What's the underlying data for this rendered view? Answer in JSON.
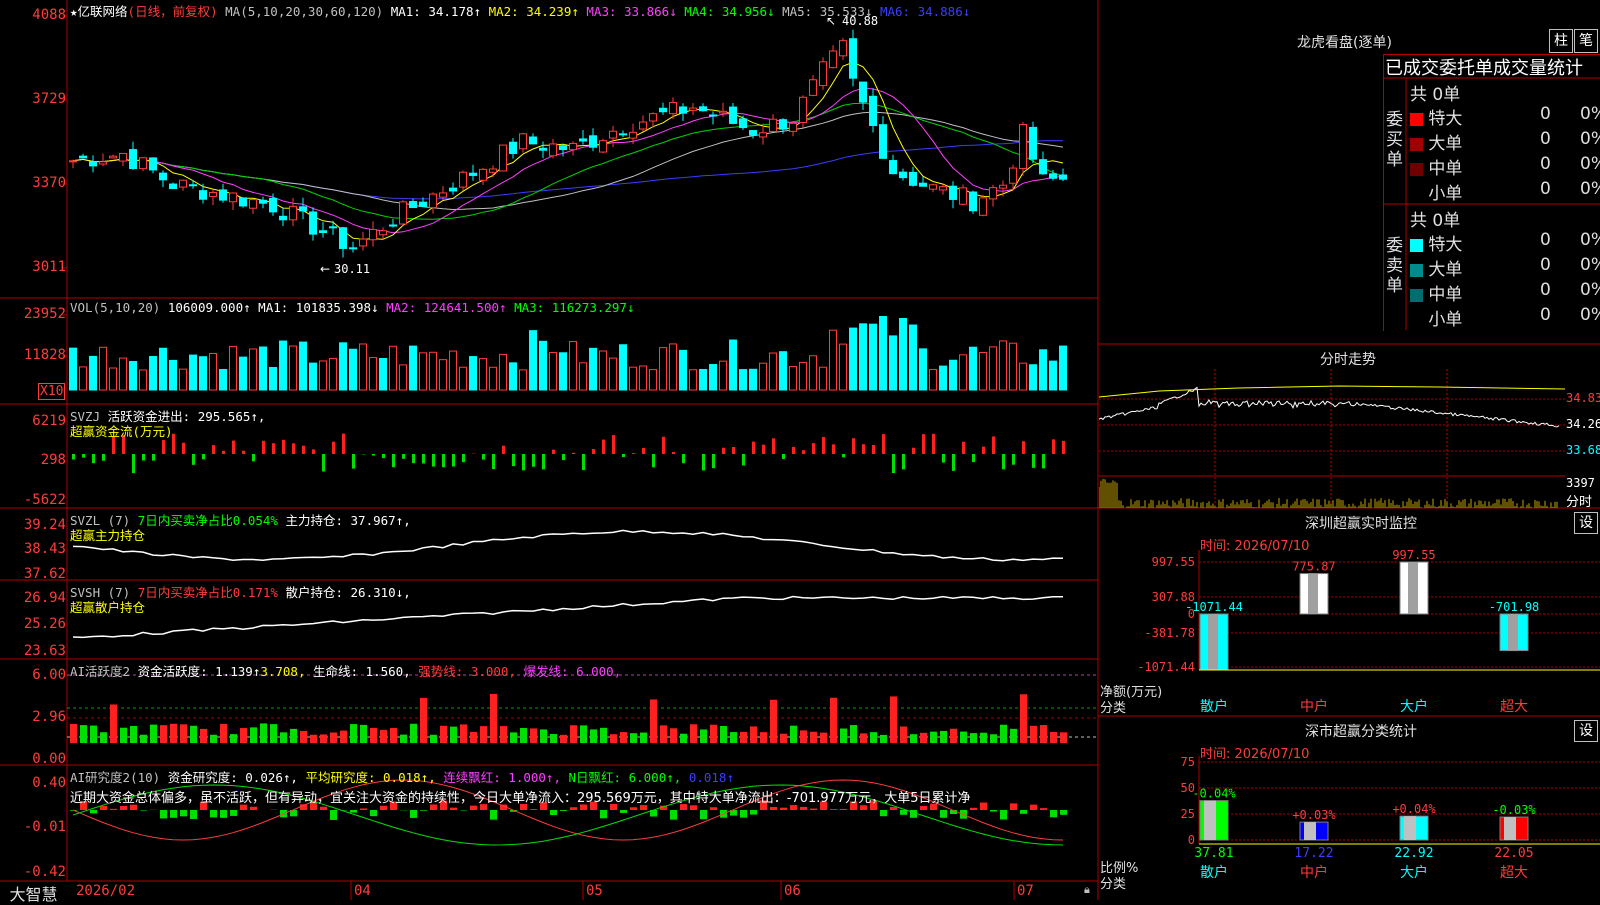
{
  "main_chart": {
    "star_icon": "★",
    "stock_name": "亿联网络",
    "period": "(日线，前复权)",
    "ma_label": "MA(5,10,20,30,60,120)",
    "ma1": "MA1: 34.178↑",
    "ma2": "MA2: 34.239↑",
    "ma3": "MA3: 33.866↓",
    "ma4": "MA4: 34.956↓",
    "ma5": "MA5: 35.533↓",
    "ma6": "MA6: 34.886↓",
    "y_ticks": [
      "4088",
      "3729",
      "3370",
      "3011"
    ],
    "high_mark": "40.88",
    "low_mark": "30.11"
  },
  "volume_panel": {
    "label": "VOL(5,10,20)",
    "value": "106009.000↑",
    "ma1": "MA1: 101835.398↓",
    "ma2": "MA2: 124641.500↑",
    "ma3": "MA3: 116273.297↓",
    "y_ticks": [
      "23952",
      "11828"
    ],
    "unit": "X10"
  },
  "svzj_panel": {
    "label": "SVZJ",
    "text": "活跃资金进出: 295.565↑,",
    "subtitle": "超赢资金流(万元)",
    "y_ticks": [
      "6219",
      "298",
      "-5622"
    ]
  },
  "svzl_panel": {
    "label": "SVZL (7)",
    "ratio": "7日内买卖净占比0.054%",
    "hold": "主力持仓: 37.967↑,",
    "subtitle": "超赢主力持仓",
    "y_ticks": [
      "39.24",
      "38.43",
      "37.62"
    ]
  },
  "svsh_panel": {
    "label": "SVSH (7)",
    "ratio": "7日内买卖净占比0.171%",
    "hold": "散户持仓: 26.310↓,",
    "subtitle": "超赢散户持仓",
    "y_ticks": [
      "26.94",
      "25.26",
      "23.63"
    ]
  },
  "ai_active_panel": {
    "label": "AI活跃度2",
    "activity": "资金活跃度: 1.139↑",
    "value2": "3.708,",
    "life": "生命线: 1.560,",
    "strong": "强势线: 3.000,",
    "burst": "爆发线: 6.000,",
    "y_ticks": [
      "6.00",
      "2.96",
      "0.00"
    ]
  },
  "ai_research_panel": {
    "label": "AI研究度2(10)",
    "research": "资金研究度: 0.026↑,",
    "avg": "平均研究度: 0.018↑,",
    "cont": "连续飘红: 1.000↑,",
    "nday": "N日飘红: 6.000↑,",
    "last": "0.018↑",
    "comment": "近期大资金总体偏多，虽不活跃，但有异动，宜关注大资金的持续性，今日大单净流入：295.569万元，其中特大单净流出：-701.977万元，大单5日累计净",
    "y_ticks": [
      "0.40",
      "-0.01",
      "-0.42"
    ]
  },
  "bottom_axis": {
    "brand": "大智慧",
    "dates": [
      "2026/02",
      "04",
      "05",
      "06",
      "07"
    ]
  },
  "dragon_tiger": {
    "title": "龙虎看盘(逐单)",
    "btn1": "柱",
    "btn2": "笔",
    "header": "已成交委托单成交量统计",
    "buy_label": "委买单",
    "sell_label": "委卖单",
    "buy_total": "共 0单",
    "sell_total": "共 0单",
    "buy_rows": [
      {
        "name": "特大",
        "value": "0",
        "pct": "0%",
        "color": "#ff0000"
      },
      {
        "name": "大单",
        "value": "0",
        "pct": "0%",
        "color": "#a00000"
      },
      {
        "name": "中单",
        "value": "0",
        "pct": "0%",
        "color": "#700000"
      },
      {
        "name": "小单",
        "value": "0",
        "pct": "0%",
        "color": "#000000"
      }
    ],
    "sell_rows": [
      {
        "name": "特大",
        "value": "0",
        "pct": "0%",
        "color": "#00ffff"
      },
      {
        "name": "大单",
        "value": "0",
        "pct": "0%",
        "color": "#008c8c"
      },
      {
        "name": "中单",
        "value": "0",
        "pct": "0%",
        "color": "#006e6e"
      },
      {
        "name": "小单",
        "value": "0",
        "pct": "0%",
        "color": "#000000"
      }
    ]
  },
  "intraday": {
    "title": "分时走势",
    "y_ticks": [
      "34.83",
      "34.26",
      "33.68"
    ],
    "vol_tick": "3397",
    "vol_label": "分时"
  },
  "sz_monitor": {
    "title": "深圳超赢实时监控",
    "btn": "设",
    "time": "时间: 2026/07/10",
    "y_ticks": [
      "997.55",
      "307.88",
      "0",
      "-381.78",
      "-1071.44"
    ],
    "label1": "净额(万元)",
    "label2": "分类",
    "bars": [
      {
        "cat": "散户",
        "value": -1071.44,
        "text": "-1071.44",
        "color": "#00ffff"
      },
      {
        "cat": "中户",
        "value": 775.87,
        "text": "775.87",
        "color": "#ffffff"
      },
      {
        "cat": "大户",
        "value": 997.55,
        "text": "997.55",
        "color": "#ffffff"
      },
      {
        "cat": "超大",
        "value": -701.98,
        "text": "-701.98",
        "color": "#00ffff"
      }
    ]
  },
  "sz_class": {
    "title": "深市超赢分类统计",
    "btn": "设",
    "time": "时间: 2026/07/10",
    "y_ticks": [
      "75",
      "50",
      "25",
      "0"
    ],
    "label1": "比例%",
    "label2": "分类",
    "bars": [
      {
        "cat": "散户",
        "value": 37.81,
        "delta": "-0.04%",
        "color": "#00ff00"
      },
      {
        "cat": "中户",
        "value": 17.22,
        "delta": "+0.03%",
        "color": "#0000ff"
      },
      {
        "cat": "大户",
        "value": 22.92,
        "delta": "+0.04%",
        "color": "#00ffff"
      },
      {
        "cat": "超大",
        "value": 22.05,
        "delta": "-0.03%",
        "color": "#ff0000"
      }
    ]
  }
}
